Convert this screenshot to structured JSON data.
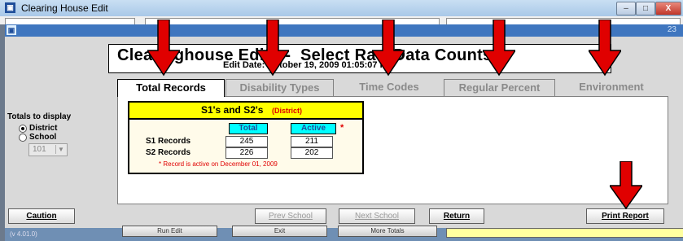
{
  "window": {
    "title": "Clearing House Edit",
    "controls": [
      "–",
      "□",
      "X"
    ]
  },
  "mdi": {
    "close": "23"
  },
  "header": {
    "title": "Clearinghouse Edit  --  Select Raw Data Counts",
    "edit_date": "Edit Date: October 19, 2009 01:05:07 PM"
  },
  "tabs": [
    "Total Records",
    "Disability Types",
    "Time Codes",
    "Regular Percent",
    "Environment"
  ],
  "sidebar": {
    "totals_label": "Totals to display",
    "options": [
      {
        "label": "District",
        "selected": true
      },
      {
        "label": "School",
        "selected": false
      }
    ],
    "school_value": "101"
  },
  "card": {
    "title": "S1's and S2's",
    "subtitle": "(District)",
    "columns": [
      "Total",
      "Active"
    ],
    "active_marker": "*",
    "rows": [
      {
        "label": "S1 Records",
        "total": "245",
        "active": "211"
      },
      {
        "label": "S2 Records",
        "total": "226",
        "active": "202"
      }
    ],
    "note": "*  Record is active on December 01, 2009"
  },
  "buttons": {
    "caution": "Caution",
    "prev_school": "Prev School",
    "next_school": "Next School",
    "return": "Return",
    "print_report": "Print Report"
  },
  "footer": {
    "version": "(v 4.01.0)",
    "buttons": [
      "Run Edit",
      "Exit",
      "More Totals"
    ]
  },
  "colors": {
    "arrow": "#e00000",
    "highlight_yellow": "#ffff00",
    "highlight_cyan": "#00ffff"
  }
}
